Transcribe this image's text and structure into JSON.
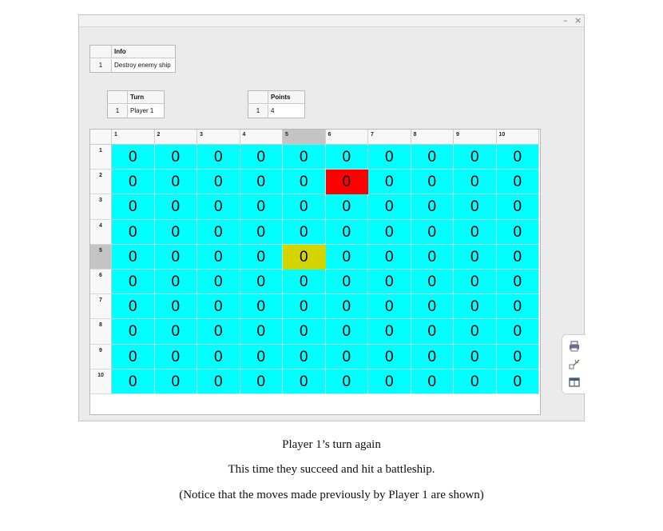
{
  "window": {
    "minimize_label": "–",
    "close_label": "×"
  },
  "info_table": {
    "header": "Info",
    "row_index": "1",
    "value": "Destroy enemy ship"
  },
  "turn_table": {
    "header": "Turn",
    "row_index": "1",
    "value": "Player 1"
  },
  "points_table": {
    "header": "Points",
    "row_index": "1",
    "value": "4"
  },
  "board": {
    "column_headers": [
      "1",
      "2",
      "3",
      "4",
      "5",
      "6",
      "7",
      "8",
      "9",
      "10"
    ],
    "row_headers": [
      "1",
      "2",
      "3",
      "4",
      "5",
      "6",
      "7",
      "8",
      "9",
      "10"
    ],
    "selected_row": "5",
    "selected_column": "5",
    "cell_value": "0",
    "cell_color": "#00ffff",
    "hit_cells": [
      {
        "row": 2,
        "col": 6,
        "color": "#fe0000"
      },
      {
        "row": 5,
        "col": 5,
        "color": "#d4d400"
      }
    ],
    "cells": [
      [
        "0",
        "0",
        "0",
        "0",
        "0",
        "0",
        "0",
        "0",
        "0",
        "0"
      ],
      [
        "0",
        "0",
        "0",
        "0",
        "0",
        "0",
        "0",
        "0",
        "0",
        "0"
      ],
      [
        "0",
        "0",
        "0",
        "0",
        "0",
        "0",
        "0",
        "0",
        "0",
        "0"
      ],
      [
        "0",
        "0",
        "0",
        "0",
        "0",
        "0",
        "0",
        "0",
        "0",
        "0"
      ],
      [
        "0",
        "0",
        "0",
        "0",
        "0",
        "0",
        "0",
        "0",
        "0",
        "0"
      ],
      [
        "0",
        "0",
        "0",
        "0",
        "0",
        "0",
        "0",
        "0",
        "0",
        "0"
      ],
      [
        "0",
        "0",
        "0",
        "0",
        "0",
        "0",
        "0",
        "0",
        "0",
        "0"
      ],
      [
        "0",
        "0",
        "0",
        "0",
        "0",
        "0",
        "0",
        "0",
        "0",
        "0"
      ],
      [
        "0",
        "0",
        "0",
        "0",
        "0",
        "0",
        "0",
        "0",
        "0",
        "0"
      ],
      [
        "0",
        "0",
        "0",
        "0",
        "0",
        "0",
        "0",
        "0",
        "0",
        "0"
      ]
    ]
  },
  "toolstrip": {
    "icons": [
      "print-icon",
      "brush-icon",
      "panel-icon"
    ]
  },
  "captions": [
    "Player 1’s turn again",
    "This time they succeed and hit a battleship.",
    "(Notice that the moves made previously by Player 1 are shown)"
  ]
}
